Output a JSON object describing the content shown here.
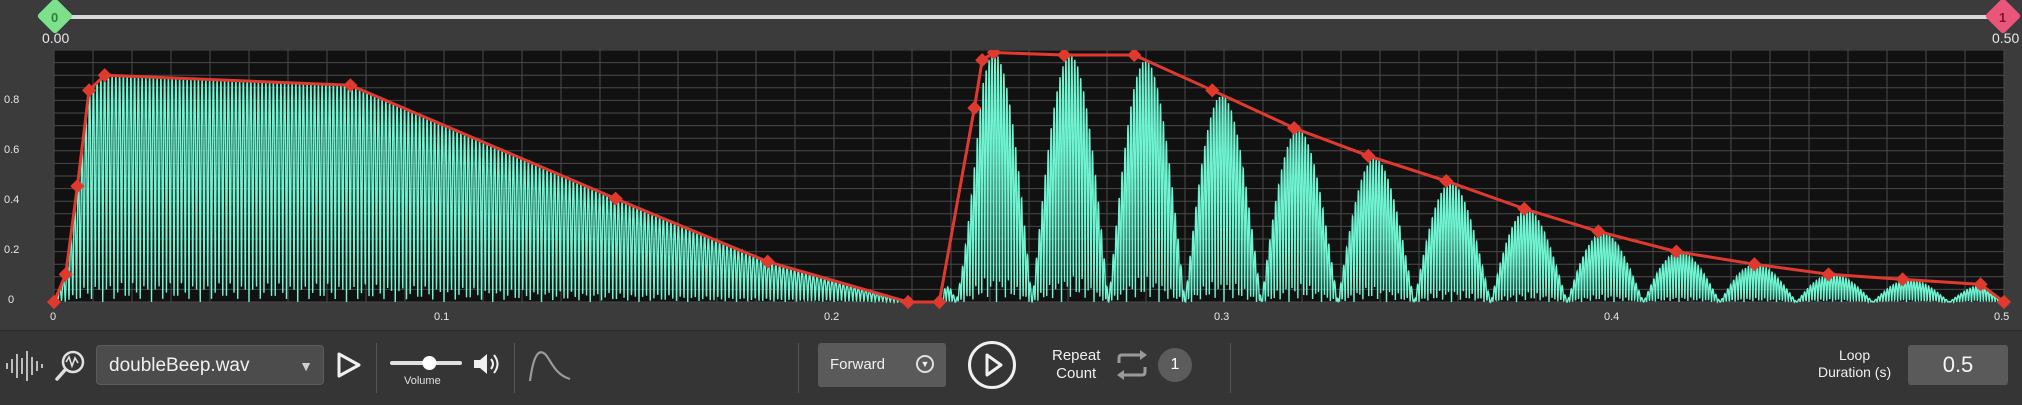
{
  "range": {
    "start_label": "0.00",
    "end_label": "0.50",
    "start_glyph": "0",
    "end_glyph": "1"
  },
  "toolbar": {
    "waveform_icon": "waveform-icon",
    "zoom_icon": "magnify-waveform-icon",
    "file_name": "doubleBeep.wav",
    "volume_label": "Volume",
    "volume_level": 0.55,
    "envelope_icon": "envelope-shape-icon",
    "direction": "Forward",
    "repeat_label_1": "Repeat",
    "repeat_label_2": "Count",
    "repeat_count": "1",
    "loop_label_1": "Loop",
    "loop_label_2": "Duration (s)",
    "loop_duration": "0.5"
  },
  "colors": {
    "waveform": "#6ff5d2",
    "envelope": "#e03a2f",
    "start_handle": "#7de08a",
    "end_handle": "#e9567a"
  },
  "chart_data": {
    "type": "line",
    "xlim": [
      0,
      0.5
    ],
    "ylim": [
      0,
      1.0
    ],
    "x_ticks": [
      "0",
      "0.1",
      "0.2",
      "0.3",
      "0.4",
      "0.5"
    ],
    "y_ticks": [
      "0",
      "0.2",
      "0.4",
      "0.6",
      "0.8"
    ],
    "grid": true,
    "envelope_points": [
      [
        0,
        0
      ],
      [
        0.003,
        0.11
      ],
      [
        0.006,
        0.46
      ],
      [
        0.009,
        0.84
      ],
      [
        0.013,
        0.9
      ],
      [
        0.076,
        0.86
      ],
      [
        0.144,
        0.41
      ],
      [
        0.183,
        0.16
      ],
      [
        0.219,
        0
      ],
      [
        0.227,
        0
      ],
      [
        0.236,
        0.77
      ],
      [
        0.238,
        0.96
      ],
      [
        0.241,
        0.99
      ],
      [
        0.259,
        0.98
      ],
      [
        0.277,
        0.98
      ],
      [
        0.297,
        0.84
      ],
      [
        0.318,
        0.69
      ],
      [
        0.337,
        0.58
      ],
      [
        0.357,
        0.48
      ],
      [
        0.377,
        0.37
      ],
      [
        0.396,
        0.28
      ],
      [
        0.416,
        0.2
      ],
      [
        0.436,
        0.15
      ],
      [
        0.455,
        0.11
      ],
      [
        0.474,
        0.09
      ],
      [
        0.494,
        0.07
      ],
      [
        0.5,
        0
      ]
    ]
  }
}
